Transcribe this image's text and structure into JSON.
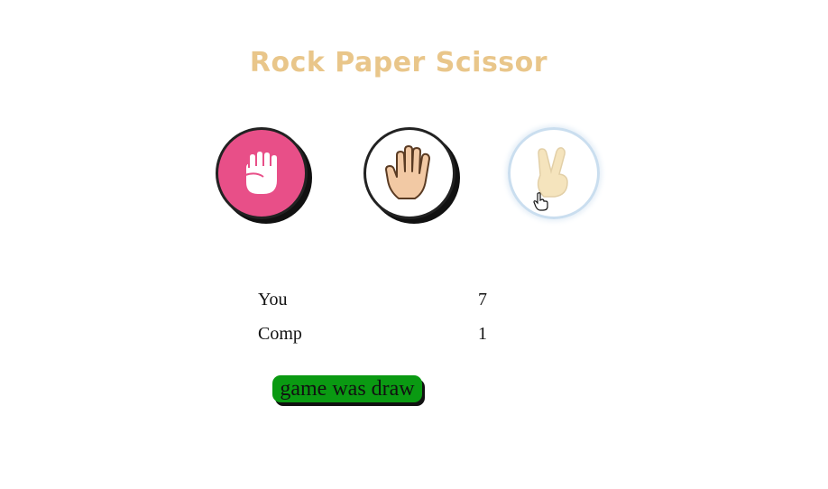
{
  "title": "Rock Paper Scissor",
  "choices": [
    {
      "name": "rock",
      "icon": "fist-icon"
    },
    {
      "name": "paper",
      "icon": "open-hand-icon"
    },
    {
      "name": "scissor",
      "icon": "peace-hand-icon"
    }
  ],
  "score": {
    "you_label": "You",
    "you_value": "7",
    "comp_label": "Comp",
    "comp_value": "1"
  },
  "result_message": "game was draw",
  "colors": {
    "title": "#e9c68a",
    "rock_bg": "#e84f88",
    "message_bg": "#0a9a12"
  }
}
